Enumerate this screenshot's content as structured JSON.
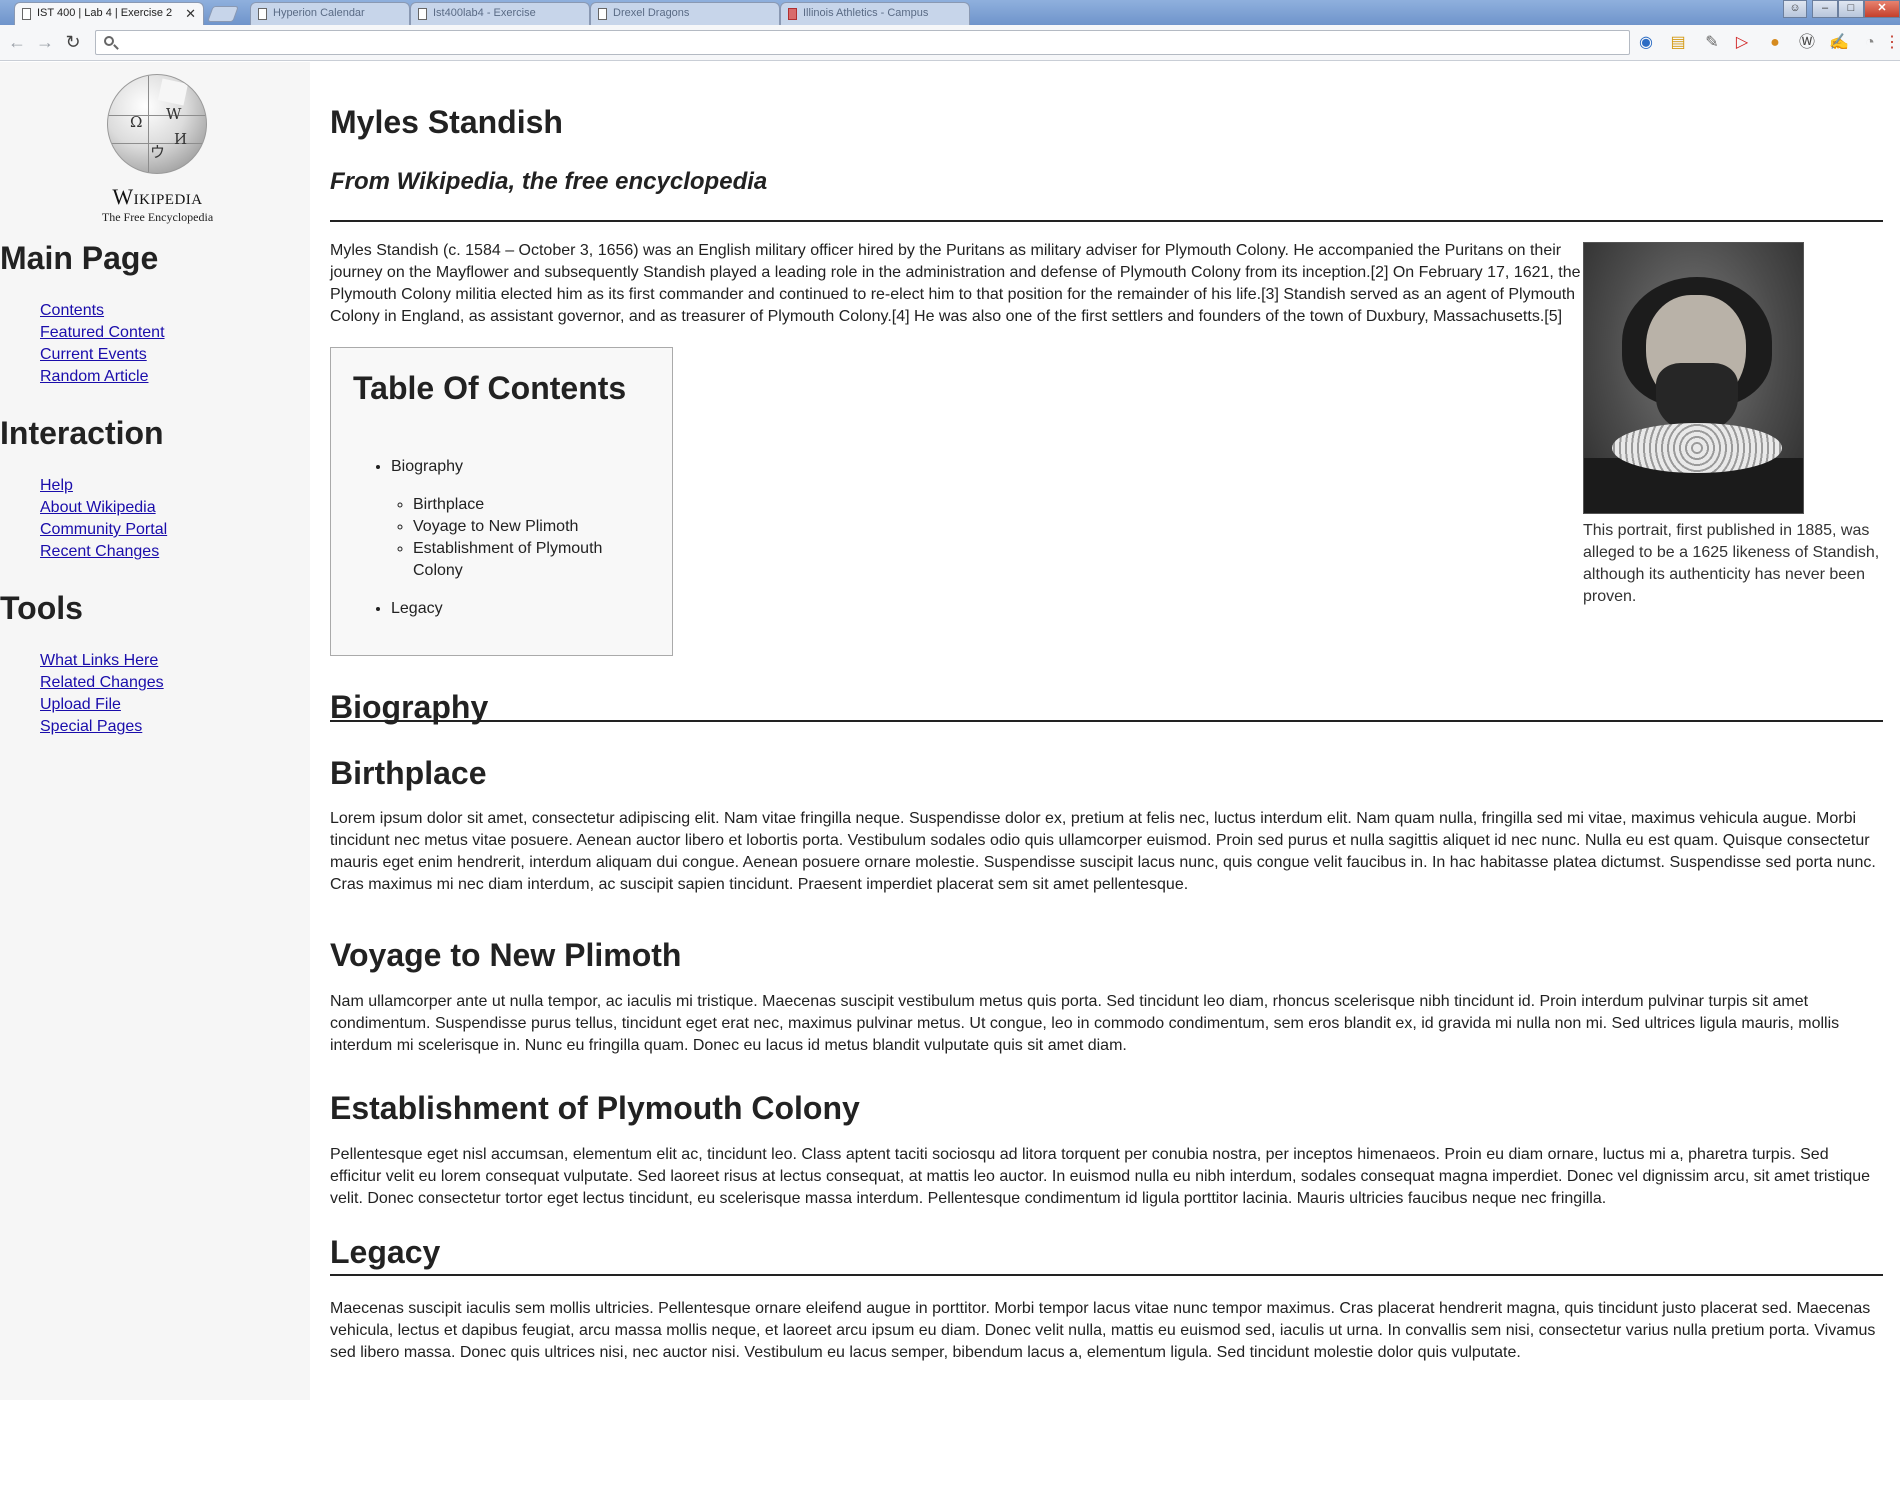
{
  "browser": {
    "active_tab": {
      "title": "IST 400 | Lab 4 | Exercise 2",
      "close": "✕"
    },
    "background_tabs": [
      {
        "title": "Hyperion Calendar"
      },
      {
        "title": "Ist400lab4 - Exercise"
      },
      {
        "title": "Drexel Dragons"
      },
      {
        "title": "Illinois Athletics - Campus"
      }
    ],
    "address": "",
    "window_controls": {
      "minimize": "–",
      "maximize": "□",
      "close": "✕"
    }
  },
  "sidebar": {
    "logo": {
      "wordmark": "Wikipedia",
      "tagline": "The Free Encyclopedia",
      "glyphs": [
        "Ω",
        "W",
        "И",
        "ウ"
      ]
    },
    "sections": [
      {
        "heading": "Main Page",
        "links": [
          "Contents",
          "Featured Content",
          "Current Events",
          "Random Article"
        ]
      },
      {
        "heading": "Interaction",
        "links": [
          "Help",
          "About Wikipedia",
          "Community Portal",
          "Recent Changes"
        ]
      },
      {
        "heading": "Tools",
        "links": [
          "What Links Here",
          "Related Changes",
          "Upload File",
          "Special Pages"
        ]
      }
    ]
  },
  "article": {
    "title": "Myles Standish",
    "subtitle": "From Wikipedia, the free encyclopedia",
    "intro": "Myles Standish (c. 1584 – October 3, 1656) was an English military officer hired by the Puritans as military adviser for Plymouth Colony. He accompanied the Puritans on their journey on the Mayflower and subsequently Standish played a leading role in the administration and defense of Plymouth Colony from its inception.[2] On February 17, 1621, the Plymouth Colony militia elected him as its first commander and continued to re-elect him to that position for the remainder of his life.[3] Standish served as an agent of Plymouth Colony in England, as assistant governor, and as treasurer of Plymouth Colony.[4] He was also one of the first settlers and founders of the town of Duxbury, Massachusetts.[5]",
    "image_caption": "This portrait, first published in 1885, was alleged to be a 1625 likeness of Standish, although its authenticity has never been proven.",
    "toc": {
      "heading": "Table Of Contents",
      "items": [
        {
          "label": "Biography",
          "children": [
            "Birthplace",
            "Voyage to New Plimoth",
            "Establishment of Plymouth Colony"
          ]
        },
        {
          "label": "Legacy"
        }
      ]
    },
    "biography_heading": "Biography",
    "sections": {
      "birthplace": {
        "heading": "Birthplace",
        "text": "Lorem ipsum dolor sit amet, consectetur adipiscing elit. Nam vitae fringilla neque. Suspendisse dolor ex, pretium at felis nec, luctus interdum elit. Nam quam nulla, fringilla sed mi vitae, maximus vehicula augue. Morbi tincidunt nec metus vitae posuere. Aenean auctor libero et lobortis porta. Vestibulum sodales odio quis ullamcorper euismod. Proin sed purus et nulla sagittis aliquet id nec nunc. Nulla eu est quam. Quisque consectetur mauris eget enim hendrerit, interdum aliquam dui congue. Aenean posuere ornare molestie. Suspendisse suscipit lacus nunc, quis congue velit faucibus in. In hac habitasse platea dictumst. Suspendisse sed porta nunc. Cras maximus mi nec diam interdum, ac suscipit sapien tincidunt. Praesent imperdiet placerat sem sit amet pellentesque."
      },
      "voyage": {
        "heading": "Voyage to New Plimoth",
        "text": "Nam ullamcorper ante ut nulla tempor, ac iaculis mi tristique. Maecenas suscipit vestibulum metus quis porta. Sed tincidunt leo diam, rhoncus scelerisque nibh tincidunt id. Proin interdum pulvinar turpis sit amet condimentum. Suspendisse purus tellus, tincidunt eget erat nec, maximus pulvinar metus. Ut congue, leo in commodo condimentum, sem eros blandit ex, id gravida mi nulla non mi. Sed ultrices ligula mauris, mollis interdum mi scelerisque in. Nunc eu fringilla quam. Donec eu lacus id metus blandit vulputate quis sit amet diam."
      },
      "establishment": {
        "heading": "Establishment of Plymouth Colony",
        "text": "Pellentesque eget nisl accumsan, elementum elit ac, tincidunt leo. Class aptent taciti sociosqu ad litora torquent per conubia nostra, per inceptos himenaeos. Proin eu diam ornare, luctus mi a, pharetra turpis. Sed efficitur velit eu lorem consequat vulputate. Sed laoreet risus at lectus consequat, at mattis leo auctor. In euismod nulla eu nibh interdum, sodales consequat magna imperdiet. Donec vel dignissim arcu, sit amet tristique velit. Donec consectetur tortor eget lectus tincidunt, eu scelerisque massa interdum. Pellentesque condimentum id ligula porttitor lacinia. Mauris ultricies faucibus neque nec fringilla."
      },
      "legacy": {
        "heading": "Legacy",
        "text": "Maecenas suscipit iaculis sem mollis ultricies. Pellentesque ornare eleifend augue in porttitor. Morbi tempor lacus vitae nunc tempor maximus. Cras placerat hendrerit magna, quis tincidunt justo placerat sed. Maecenas vehicula, lectus et dapibus feugiat, arcu massa mollis neque, et laoreet arcu ipsum eu diam. Donec velit nulla, mattis eu euismod sed, iaculis ut urna. In convallis sem nisi, consectetur varius nulla pretium porta. Vivamus sed libero massa. Donec quis ultrices nisi, nec auctor nisi. Vestibulum eu lacus semper, bibendum lacus a, elementum ligula. Sed tincidunt molestie dolor quis vulputate."
      }
    }
  }
}
